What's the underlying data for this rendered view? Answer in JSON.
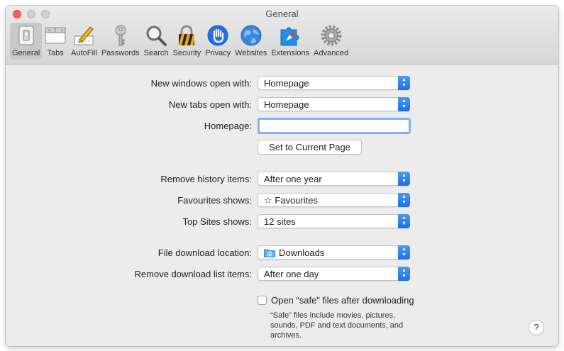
{
  "window": {
    "title": "General"
  },
  "toolbar": {
    "items": [
      {
        "label": "General",
        "icon": "general-switch-icon"
      },
      {
        "label": "Tabs",
        "icon": "tabs-icon"
      },
      {
        "label": "AutoFill",
        "icon": "pencil-form-icon"
      },
      {
        "label": "Passwords",
        "icon": "key-icon"
      },
      {
        "label": "Search",
        "icon": "magnifier-icon"
      },
      {
        "label": "Security",
        "icon": "padlock-icon"
      },
      {
        "label": "Privacy",
        "icon": "hand-icon"
      },
      {
        "label": "Websites",
        "icon": "globe-icon"
      },
      {
        "label": "Extensions",
        "icon": "puzzle-compass-icon"
      },
      {
        "label": "Advanced",
        "icon": "gear-icon"
      }
    ],
    "selected": "General"
  },
  "settings": {
    "new_windows": {
      "label": "New windows open with:",
      "value": "Homepage"
    },
    "new_tabs": {
      "label": "New tabs open with:",
      "value": "Homepage"
    },
    "homepage": {
      "label": "Homepage:",
      "value": ""
    },
    "set_current_button": "Set to Current Page",
    "remove_history": {
      "label": "Remove history items:",
      "value": "After one year"
    },
    "favourites": {
      "label": "Favourites shows:",
      "value": "Favourites",
      "value_icon": "☆"
    },
    "top_sites": {
      "label": "Top Sites shows:",
      "value": "12 sites"
    },
    "download_location": {
      "label": "File download location:",
      "value": "Downloads"
    },
    "remove_download": {
      "label": "Remove download list items:",
      "value": "After one day"
    },
    "open_safe": {
      "label": "Open “safe” files after downloading",
      "checked": false,
      "note": "“Safe” files include movies, pictures, sounds, PDF and text documents, and archives."
    }
  },
  "help": {
    "label": "?"
  },
  "colors": {
    "accent": "#1c6fe6",
    "focus_ring": "#7fb2f3",
    "close": "#fc605c"
  }
}
